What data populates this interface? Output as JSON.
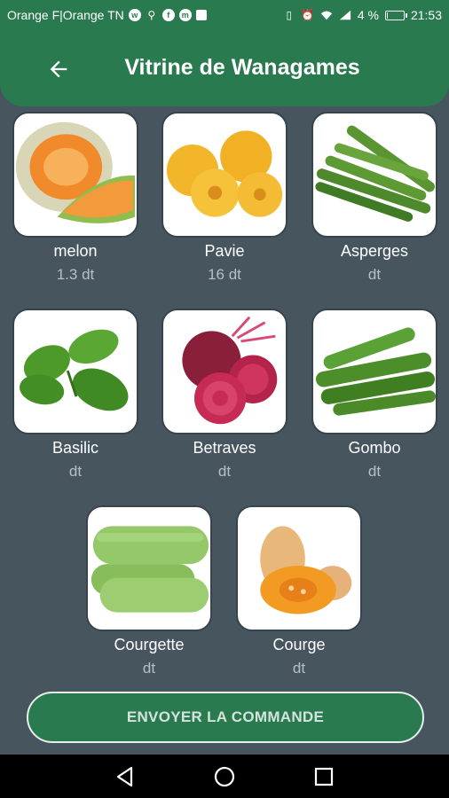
{
  "status_bar": {
    "carrier": "Orange F|Orange TN",
    "battery_percent": "4 %",
    "battery_level": 0.04,
    "time": "21:53",
    "icons": [
      "whatsapp-icon",
      "usb-icon",
      "facebook-icon",
      "messenger-icon",
      "app-icon",
      "vibrate-icon",
      "alarm-icon",
      "wifi-icon",
      "signal-icon",
      "battery-icon"
    ]
  },
  "app_bar": {
    "title": "Vitrine de Wanagames",
    "back_icon": "arrow-left-icon"
  },
  "products": [
    {
      "name": "melon",
      "price": "1.3 dt"
    },
    {
      "name": "Pavie",
      "price": "16 dt"
    },
    {
      "name": "Asperges",
      "price": "dt"
    },
    {
      "name": "Basilic",
      "price": "dt"
    },
    {
      "name": "Betraves",
      "price": "dt"
    },
    {
      "name": "Gombo",
      "price": "dt"
    },
    {
      "name": "Courgette",
      "price": "dt"
    },
    {
      "name": "Courge",
      "price": "dt"
    }
  ],
  "order_button": {
    "label": "ENVOYER LA COMMANDE"
  },
  "nav_bar": {
    "icons": [
      "back-triangle-icon",
      "home-circle-icon",
      "recents-square-icon"
    ]
  },
  "colors": {
    "primary": "#2a7a50",
    "background": "#47555f",
    "price_text": "#b7bfc4"
  }
}
